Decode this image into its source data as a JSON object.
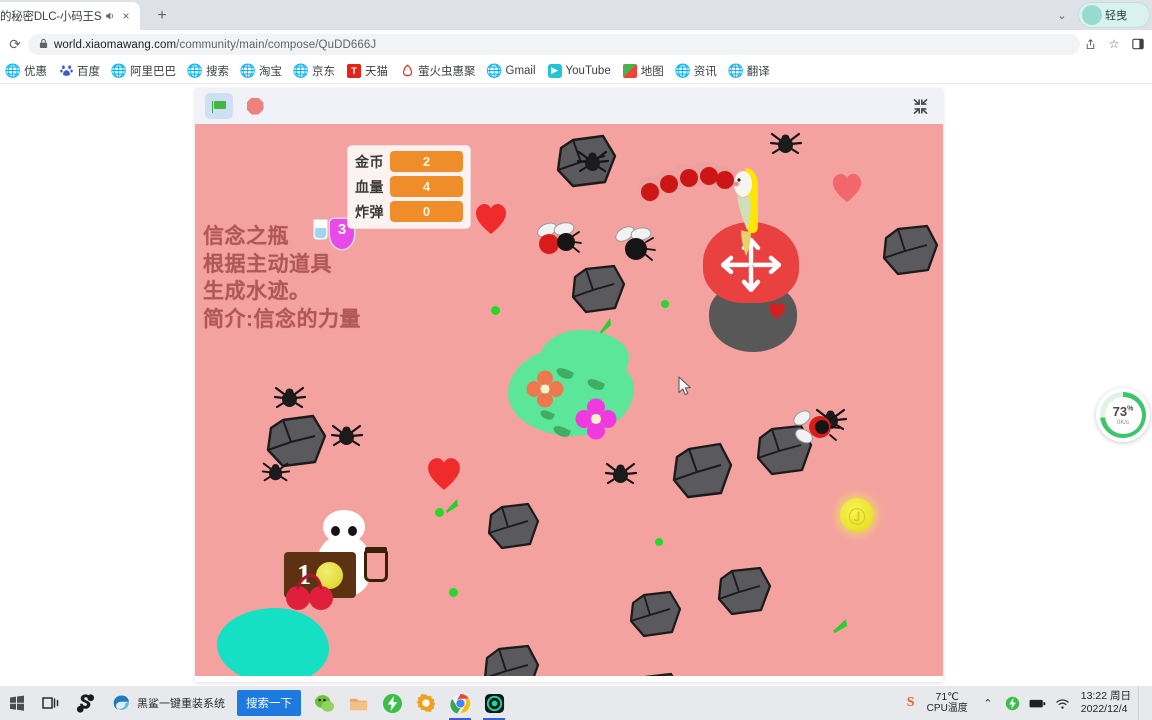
{
  "browser": {
    "tab": {
      "title": "的秘密DLC-小码王Sc",
      "audio_icon": "speaker-icon",
      "close_icon": "×"
    },
    "newtab_icon": "+",
    "tabstrip_chevron": "⌄",
    "profile_name": "轻曳",
    "reload_icon": "⟳",
    "lock_icon": "🔒",
    "url_domain": "world.xiaomawang.com",
    "url_path": "/community/main/compose/QuDD666J",
    "share_icon": "share-icon",
    "star_icon": "☆",
    "sidepanel_icon": "▯"
  },
  "bookmarks": [
    {
      "label": "优惠",
      "icon": "globe-icon",
      "icon_kind": "globe"
    },
    {
      "label": "百度",
      "icon": "baidu-icon",
      "icon_kind": "baidu"
    },
    {
      "label": "阿里巴巴",
      "icon": "globe-icon",
      "icon_kind": "globe"
    },
    {
      "label": "搜索",
      "icon": "globe-icon",
      "icon_kind": "globe"
    },
    {
      "label": "淘宝",
      "icon": "globe-icon",
      "icon_kind": "globe"
    },
    {
      "label": "京东",
      "icon": "globe-icon",
      "icon_kind": "globe"
    },
    {
      "label": "天猫",
      "icon": "tmall-icon",
      "icon_kind": "tmall"
    },
    {
      "label": "萤火虫惠聚",
      "icon": "firefly-icon",
      "icon_kind": "firefly"
    },
    {
      "label": "Gmail",
      "icon": "globe-icon",
      "icon_kind": "globe"
    },
    {
      "label": "YouTube",
      "icon": "youtube-icon",
      "icon_kind": "youtube"
    },
    {
      "label": "地图",
      "icon": "map-icon",
      "icon_kind": "map"
    },
    {
      "label": "资讯",
      "icon": "globe-icon",
      "icon_kind": "globe"
    },
    {
      "label": "翻译",
      "icon": "globe-icon",
      "icon_kind": "globe"
    }
  ],
  "game": {
    "toolbar": {
      "green_flag_icon": "green-flag-icon",
      "stop_icon": "stop-sign-icon",
      "fullscreen_icon": "exit-fullscreen-icon"
    },
    "hud": [
      {
        "label": "金币",
        "value": "2"
      },
      {
        "label": "血量",
        "value": "4"
      },
      {
        "label": "炸弹",
        "value": "0"
      }
    ],
    "item_text": "信念之瓶\n根据主动道具\n生成水迹。\n简介:信念的力量",
    "item_badge_count": "3",
    "sign_number": "1",
    "stage_bg_color": "#f4a2a0",
    "hud_value_color": "#f08d2b"
  },
  "netspeed": {
    "percent": "73",
    "percent_unit": "%",
    "speed": "0K/s",
    "accent_color": "#3ec46b"
  },
  "taskbar": {
    "start_icon": "start-icon",
    "taskview_icon": "task-view-icon",
    "sogou_icon": "sogou-icon",
    "edge_icon": "edge-icon",
    "edge_label": "黑鲨一键重装系统",
    "search_button": "搜索一下",
    "apps": [
      {
        "name": "wechat-icon"
      },
      {
        "name": "folder-icon"
      },
      {
        "name": "thunder-icon"
      },
      {
        "name": "settings-icon"
      },
      {
        "name": "chrome-icon"
      },
      {
        "name": "scratch-icon"
      }
    ],
    "tray": {
      "sogou_letter": "S",
      "cpu_temp": "71℃",
      "cpu_label": "CPU温度",
      "chevron_up": "⌃",
      "battery_icon": "battery-icon",
      "wifi_icon": "wifi-icon",
      "time": "13:22 周日",
      "date": "2022/12/4"
    }
  }
}
